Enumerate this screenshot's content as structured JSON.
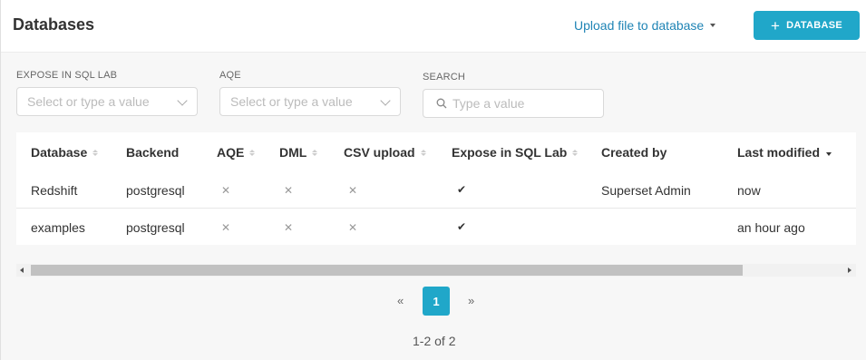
{
  "header": {
    "title": "Databases",
    "upload_label": "Upload file to database",
    "add_button_label": "DATABASE",
    "accent_color": "#20a7c9"
  },
  "filters": {
    "expose": {
      "label": "EXPOSE IN SQL LAB",
      "placeholder": "Select or type a value"
    },
    "aqe": {
      "label": "AQE",
      "placeholder": "Select or type a value"
    },
    "search": {
      "label": "SEARCH",
      "placeholder": "Type a value"
    }
  },
  "table": {
    "columns": [
      "Database",
      "Backend",
      "AQE",
      "DML",
      "CSV upload",
      "Expose in SQL Lab",
      "Created by",
      "Last modified"
    ],
    "rows": [
      {
        "database": "Redshift",
        "backend": "postgresql",
        "aqe": "✕",
        "dml": "✕",
        "csv_upload": "✕",
        "expose": "✔",
        "created_by": "Superset Admin",
        "last_modified": "now"
      },
      {
        "database": "examples",
        "backend": "postgresql",
        "aqe": "✕",
        "dml": "✕",
        "csv_upload": "✕",
        "expose": "✔",
        "created_by": "",
        "last_modified": "an hour ago"
      }
    ]
  },
  "pagination": {
    "prev": "«",
    "current": "1",
    "next": "»",
    "summary": "1-2 of 2"
  }
}
